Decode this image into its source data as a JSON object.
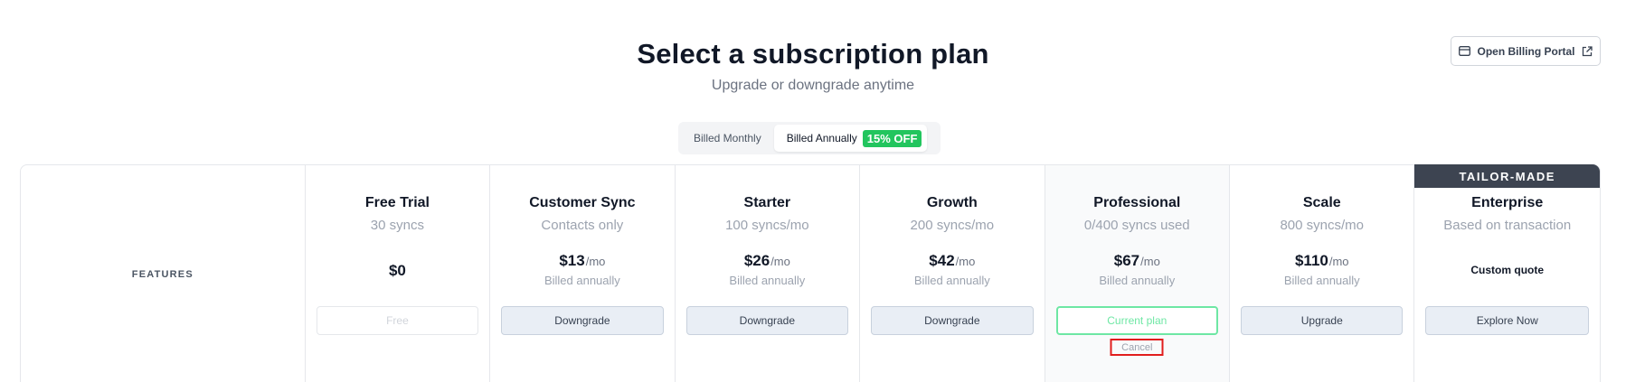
{
  "header": {
    "title": "Select a subscription plan",
    "subtitle": "Upgrade or downgrade anytime"
  },
  "billing_portal": {
    "label": "Open Billing Portal",
    "icon_left": "credit-card-icon",
    "icon_right": "external-link-icon"
  },
  "toggle": {
    "monthly": "Billed Monthly",
    "annually": "Billed Annually",
    "discount_badge": "15% OFF",
    "selected": "annually"
  },
  "table": {
    "features_label": "FEATURES",
    "plans": [
      {
        "name": "Free Trial",
        "sub": "30 syncs",
        "price": "$0",
        "per": "",
        "billed": "",
        "button": "Free"
      },
      {
        "name": "Customer Sync",
        "sub": "Contacts only",
        "price": "$13",
        "per": "/mo",
        "billed": "Billed annually",
        "button": "Downgrade"
      },
      {
        "name": "Starter",
        "sub": "100 syncs/mo",
        "price": "$26",
        "per": "/mo",
        "billed": "Billed annually",
        "button": "Downgrade"
      },
      {
        "name": "Growth",
        "sub": "200 syncs/mo",
        "price": "$42",
        "per": "/mo",
        "billed": "Billed annually",
        "button": "Downgrade"
      },
      {
        "name": "Professional",
        "sub": "0/400 syncs used",
        "price": "$67",
        "per": "/mo",
        "billed": "Billed annually",
        "button": "Current plan",
        "cancel": "Cancel"
      },
      {
        "name": "Scale",
        "sub": "800 syncs/mo",
        "price": "$110",
        "per": "/mo",
        "billed": "Billed annually",
        "button": "Upgrade"
      },
      {
        "name": "Enterprise",
        "sub": "Based on transaction",
        "price": "Custom quote",
        "button": "Explore Now",
        "tag": "TAILOR-MADE"
      }
    ]
  },
  "colors": {
    "badge": "#22c55e",
    "current_plan_border": "#6ee7a4",
    "highlight_box": "#e11d1d",
    "tailor_banner": "#3d4451"
  }
}
